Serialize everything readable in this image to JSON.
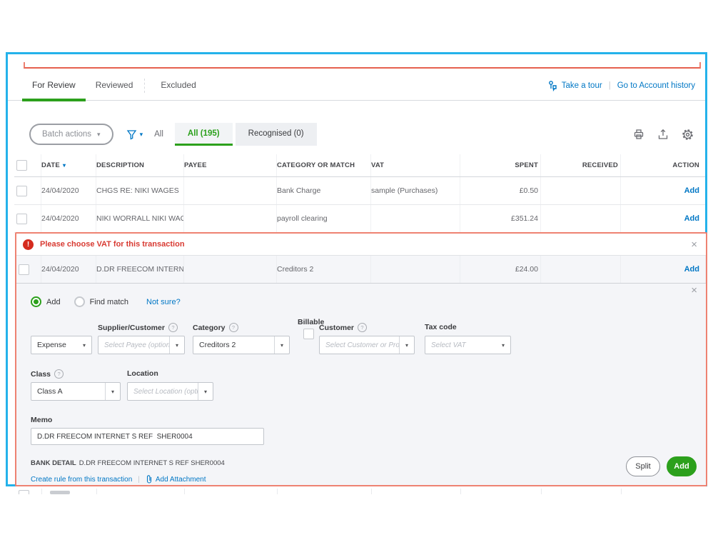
{
  "colors": {
    "accent_green": "#2ca01c",
    "link_blue": "#0077c5",
    "error_red": "#d52b1e",
    "highlight_blue_border": "#24b2ea",
    "highlight_red_border": "#ee8272"
  },
  "icons": {
    "caret_down": "▾",
    "close": "×",
    "pipe": "|",
    "error_exclaim": "!",
    "info": "?"
  },
  "tabs": {
    "for_review": "For Review",
    "reviewed": "Reviewed",
    "excluded": "Excluded"
  },
  "header_links": {
    "take_a_tour": "Take a tour",
    "go_to_account_history": "Go to Account history"
  },
  "toolbar": {
    "batch_actions_label": "Batch actions",
    "all_filter_label": "All",
    "chip_all": "All (195)",
    "chip_recognised": "Recognised (0)"
  },
  "table": {
    "headers": {
      "date": "DATE",
      "description": "DESCRIPTION",
      "payee": "PAYEE",
      "category": "CATEGORY OR MATCH",
      "vat": "VAT",
      "spent": "SPENT",
      "received": "RECEIVED",
      "action": "ACTION"
    },
    "rows": [
      {
        "date": "24/04/2020",
        "description": "CHGS RE: NIKI WAGES",
        "payee": "",
        "category": "Bank Charge",
        "vat": "sample (Purchases)",
        "spent": "£0.50",
        "received": "",
        "action": "Add"
      },
      {
        "date": "24/04/2020",
        "description": "NIKI WORRALL NIKI WAGES",
        "payee": "",
        "category": "payroll clearing",
        "vat": "",
        "spent": "£351.24",
        "received": "",
        "action": "Add"
      }
    ]
  },
  "error_banner": {
    "message": "Please choose VAT for this transaction"
  },
  "selected_row": {
    "date": "24/04/2020",
    "description": "D.DR FREECOM INTERNET S REF S...",
    "category": "Creditors 2",
    "spent": "£24.00",
    "action": "Add"
  },
  "form": {
    "radio_add": "Add",
    "radio_find_match": "Find match",
    "not_sure_link": "Not sure?",
    "type_value": "Expense",
    "supplier_label": "Supplier/Customer",
    "supplier_placeholder": "Select Payee (optional)",
    "category_label": "Category",
    "category_value": "Creditors 2",
    "billable_label": "Billable",
    "customer_label": "Customer",
    "customer_placeholder": "Select Customer or Project (option",
    "tax_code_label": "Tax code",
    "tax_code_placeholder": "Select VAT",
    "class_label": "Class",
    "class_value": "Class A",
    "location_label": "Location",
    "location_placeholder": "Select Location (optional)",
    "memo_label": "Memo",
    "memo_value": "D.DR FREECOM INTERNET S REF  SHER0004",
    "bank_detail_label": "BANK DETAIL",
    "bank_detail_value": "D.DR FREECOM INTERNET S REF SHER0004",
    "create_rule_link": "Create rule from this transaction",
    "attachment_link": "Add Attachment",
    "split_button": "Split",
    "add_button": "Add"
  }
}
